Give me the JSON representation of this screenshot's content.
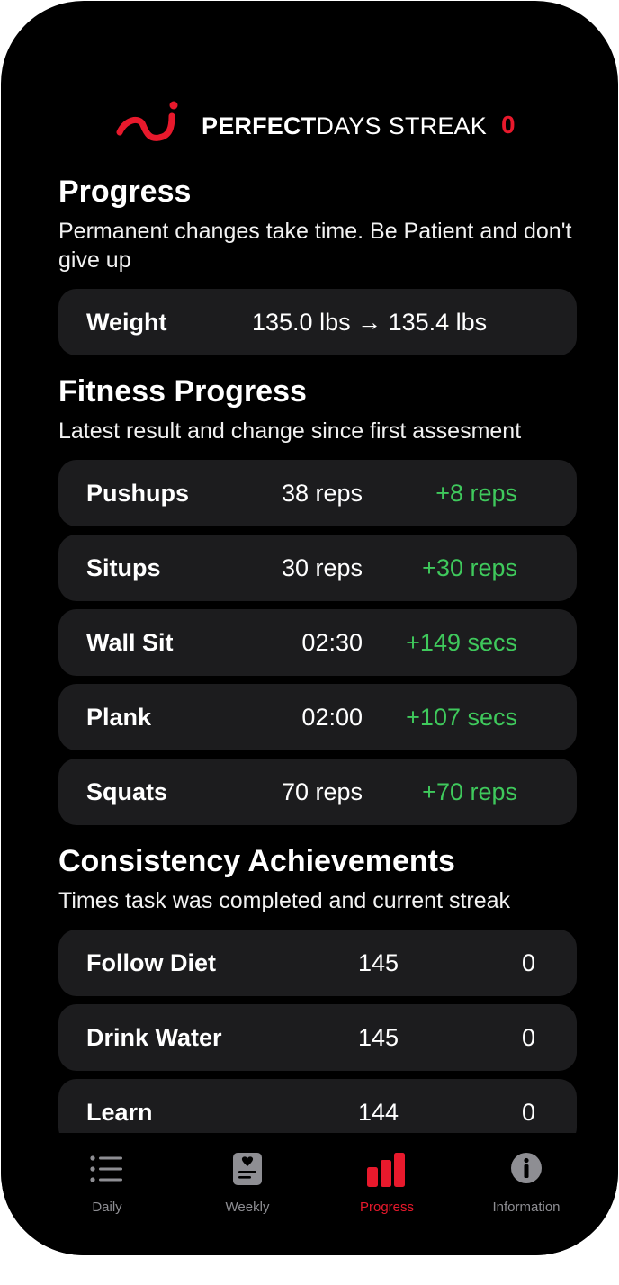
{
  "header": {
    "brand_bold": "PERFECT",
    "brand_regular": "DAYS",
    "streak_label": "STREAK",
    "streak_count": "0",
    "accent_color": "#e8192c"
  },
  "progress": {
    "title": "Progress",
    "subtitle": "Permanent changes take time. Be Patient and don't give up",
    "weight": {
      "label": "Weight",
      "value": "135.0 lbs  →  135.4 lbs"
    }
  },
  "fitness": {
    "title": "Fitness Progress",
    "subtitle": "Latest result and change since first assesment",
    "items": [
      {
        "label": "Pushups",
        "latest": "38 reps",
        "change": "+8 reps"
      },
      {
        "label": "Situps",
        "latest": "30 reps",
        "change": "+30 reps"
      },
      {
        "label": "Wall Sit",
        "latest": "02:30",
        "change": "+149 secs"
      },
      {
        "label": "Plank",
        "latest": "02:00",
        "change": "+107 secs"
      },
      {
        "label": "Squats",
        "latest": "70 reps",
        "change": "+70 reps"
      }
    ]
  },
  "consistency": {
    "title": "Consistency Achievements",
    "subtitle": "Times task was completed and current streak",
    "items": [
      {
        "label": "Follow Diet",
        "completed": "145",
        "streak": "0"
      },
      {
        "label": "Drink Water",
        "completed": "145",
        "streak": "0"
      },
      {
        "label": "Learn",
        "completed": "144",
        "streak": "0"
      }
    ]
  },
  "tabs": [
    {
      "label": "Daily",
      "icon": "list-icon"
    },
    {
      "label": "Weekly",
      "icon": "journal-icon"
    },
    {
      "label": "Progress",
      "icon": "bar-chart-icon"
    },
    {
      "label": "Information",
      "icon": "info-icon"
    }
  ],
  "colors": {
    "positive": "#3fc95c",
    "card": "#1c1c1e",
    "inactive_tab": "#8e8e93"
  }
}
